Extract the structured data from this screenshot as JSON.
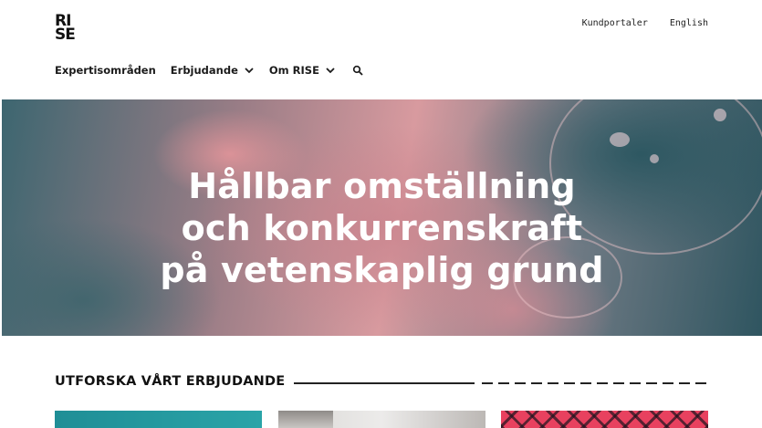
{
  "brand": {
    "logo_line1": "RI",
    "logo_line2": "SE"
  },
  "utility_nav": {
    "portal": "Kundportaler",
    "language": "English"
  },
  "main_nav": {
    "items": [
      {
        "label": "Expertisområden"
      },
      {
        "label": "Erbjudande"
      },
      {
        "label": "Om RISE"
      }
    ]
  },
  "hero": {
    "lines": [
      "Hållbar omställning",
      "och konkurrenskraft",
      "på vetenskaplig grund"
    ]
  },
  "section": {
    "title": "UTFORSKA VÅRT ERBJUDANDE"
  },
  "colors": {
    "hero_teal": "#3d6670",
    "hero_pink": "#d89a9f",
    "card_teal": "#1f8e96",
    "card_red": "#e8415f"
  },
  "icons": {
    "dropdown": "chevron-down-icon",
    "search": "search-icon"
  }
}
